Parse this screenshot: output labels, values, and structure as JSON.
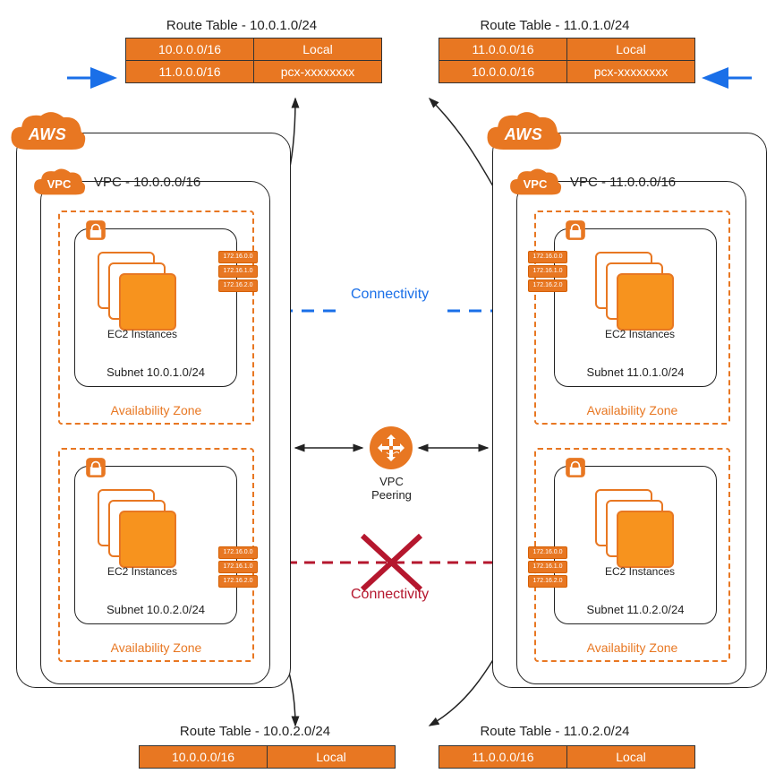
{
  "route_tables": {
    "top_left": {
      "title": "Route Table - 10.0.1.0/24",
      "rows": [
        {
          "dest": "10.0.0.0/16",
          "target": "Local"
        },
        {
          "dest": "11.0.0.0/16",
          "target": "pcx-xxxxxxxx"
        }
      ]
    },
    "top_right": {
      "title": "Route Table - 11.0.1.0/24",
      "rows": [
        {
          "dest": "11.0.0.0/16",
          "target": "Local"
        },
        {
          "dest": "10.0.0.0/16",
          "target": "pcx-xxxxxxxx"
        }
      ]
    },
    "bottom_left": {
      "title": "Route Table - 10.0.2.0/24",
      "rows": [
        {
          "dest": "10.0.0.0/16",
          "target": "Local"
        }
      ]
    },
    "bottom_right": {
      "title": "Route Table - 11.0.2.0/24",
      "rows": [
        {
          "dest": "11.0.0.0/16",
          "target": "Local"
        }
      ]
    }
  },
  "left_region": {
    "cloud_label": "AWS",
    "vpc": {
      "cloud_label": "VPC",
      "cidr": "VPC - 10.0.0.0/16",
      "az1": {
        "label": "Availability Zone",
        "subnet": {
          "label": "Subnet 10.0.1.0/24",
          "ec2_label": "EC2 Instances"
        },
        "rt_icon_rows": [
          "172.16.0.0",
          "172.16.1.0",
          "172.16.2.0"
        ]
      },
      "az2": {
        "label": "Availability Zone",
        "subnet": {
          "label": "Subnet 10.0.2.0/24",
          "ec2_label": "EC2 Instances"
        },
        "rt_icon_rows": [
          "172.16.0.0",
          "172.16.1.0",
          "172.16.2.0"
        ]
      }
    }
  },
  "right_region": {
    "cloud_label": "AWS",
    "vpc": {
      "cloud_label": "VPC",
      "cidr": "VPC - 11.0.0.0/16",
      "az1": {
        "label": "Availability Zone",
        "subnet": {
          "label": "Subnet 11.0.1.0/24",
          "ec2_label": "EC2 Instances"
        },
        "rt_icon_rows": [
          "172.16.0.0",
          "172.16.1.0",
          "172.16.2.0"
        ]
      },
      "az2": {
        "label": "Availability Zone",
        "subnet": {
          "label": "Subnet 11.0.2.0/24",
          "ec2_label": "EC2 Instances"
        },
        "rt_icon_rows": [
          "172.16.0.0",
          "172.16.1.0",
          "172.16.2.0"
        ]
      }
    }
  },
  "center": {
    "peering_label": "VPC\nPeering",
    "connectivity_ok": "Connectivity",
    "connectivity_blocked": "Connectivity"
  }
}
